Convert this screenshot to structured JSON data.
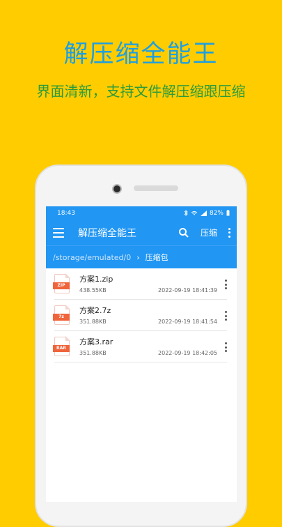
{
  "promo": {
    "headline": "解压缩全能王",
    "tagline": "界面清新，支持文件解压缩跟压缩"
  },
  "status": {
    "time": "18:43",
    "battery": "82%"
  },
  "appbar": {
    "title": "解压缩全能王",
    "compress_label": "压缩",
    "search_icon": "search-icon",
    "more_icon": "more-vert-icon",
    "menu_icon": "hamburger-menu-icon"
  },
  "path": {
    "root": "/storage/emulated/0",
    "separator": "›",
    "current": "压缩包"
  },
  "files": [
    {
      "name": "方案1.zip",
      "size": "438.55KB",
      "date": "2022-09-19 18:41:39",
      "badge": "ZIP"
    },
    {
      "name": "方案2.7z",
      "size": "351.88KB",
      "date": "2022-09-19 18:41:54",
      "badge": "7z"
    },
    {
      "name": "方案3.rar",
      "size": "351.88KB",
      "date": "2022-09-19 18:42:05",
      "badge": "RAR"
    }
  ],
  "colors": {
    "background": "#FFCC00",
    "appbar": "#2196F3",
    "headline": "#1E9FE0",
    "tagline": "#2C9B3A",
    "file_badge": "#F0643C"
  }
}
